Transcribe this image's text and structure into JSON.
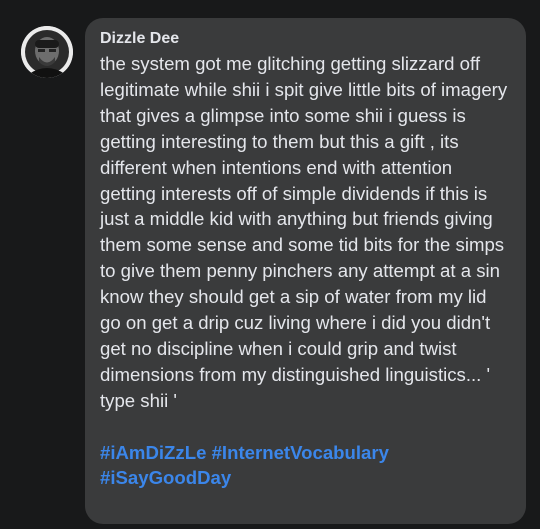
{
  "comment": {
    "author": "Dizzle Dee",
    "text": "the system got me glitching getting slizzard off legitimate while shii i spit give little bits of imagery that gives a glimpse into some shii i guess is getting interesting to them but this a gift , its different when intentions end with attention getting interests off of simple dividends if this is just a middle kid with anything but friends giving them some sense and some tid bits for the simps to give them penny pinchers any attempt at a sin know they should get a sip of water from my lid go on get a drip cuz living where i did you didn't get no discipline when i could grip and twist dimensions from my distinguished linguistics... ' type shii '",
    "hashtags": [
      "#iAmDiZzLe",
      "#InternetVocabulary",
      "#iSayGoodDay"
    ]
  },
  "colors": {
    "background": "#18191a",
    "bubble": "#3a3b3c",
    "text": "#e4e6eb",
    "hashtag": "#3b86ea"
  }
}
